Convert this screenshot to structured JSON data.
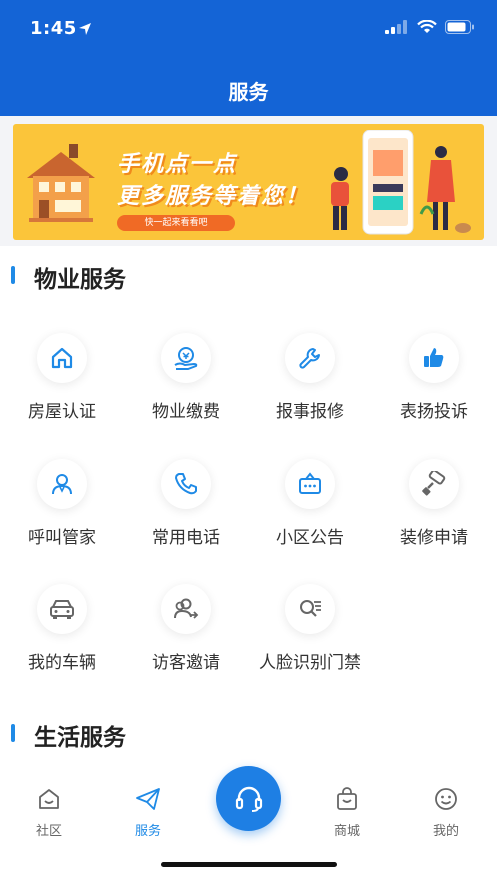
{
  "status": {
    "time": "1:45"
  },
  "header": {
    "title": "服务"
  },
  "banner": {
    "line1": "手机点一点",
    "line2": "更多服务等着您！",
    "pill": "快一起来看看吧"
  },
  "sections": {
    "property": "物业服务",
    "life": "生活服务"
  },
  "property_services": [
    {
      "label": "房屋认证",
      "icon": "house-icon"
    },
    {
      "label": "物业缴费",
      "icon": "payment-icon"
    },
    {
      "label": "报事报修",
      "icon": "wrench-icon"
    },
    {
      "label": "表扬投诉",
      "icon": "thumbs-up-icon"
    },
    {
      "label": "呼叫管家",
      "icon": "butler-icon"
    },
    {
      "label": "常用电话",
      "icon": "phone-icon"
    },
    {
      "label": "小区公告",
      "icon": "notice-icon"
    },
    {
      "label": "装修申请",
      "icon": "paint-roller-icon"
    },
    {
      "label": "我的车辆",
      "icon": "car-icon"
    },
    {
      "label": "访客邀请",
      "icon": "visitor-icon"
    },
    {
      "label": "人脸识别门禁",
      "icon": "face-id-icon"
    }
  ],
  "tabbar": {
    "items": [
      {
        "label": "社区",
        "icon": "home-icon"
      },
      {
        "label": "服务",
        "icon": "paper-plane-icon"
      },
      {
        "label": "商城",
        "icon": "shopping-bag-icon"
      },
      {
        "label": "我的",
        "icon": "smiley-icon"
      }
    ],
    "center_icon": "headset-icon"
  },
  "colors": {
    "header": "#1464d6",
    "accent": "#1f8ae6",
    "banner": "#fbc53a"
  }
}
